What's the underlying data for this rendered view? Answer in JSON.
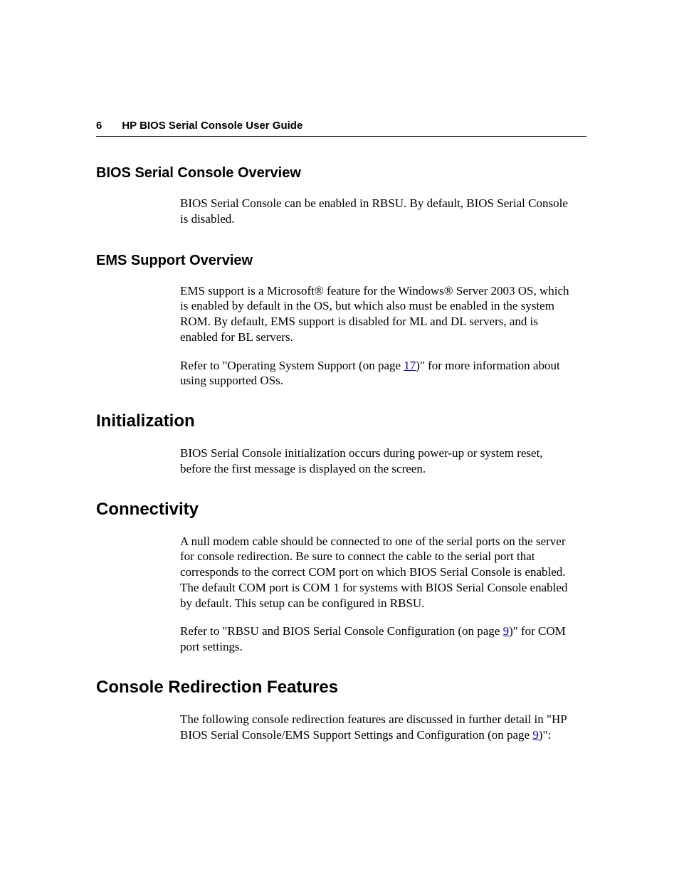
{
  "header": {
    "pageNumber": "6",
    "runningTitle": "HP BIOS Serial Console User Guide"
  },
  "sections": {
    "bios_overview": {
      "heading": "BIOS Serial Console Overview",
      "p1": "BIOS Serial Console can be enabled in RBSU. By default, BIOS Serial Console is disabled."
    },
    "ems_overview": {
      "heading": "EMS Support Overview",
      "p1": "EMS support is a Microsoft® feature for the Windows® Server 2003 OS, which is enabled by default in the OS, but which also must be enabled in the system ROM. By default, EMS support is disabled for ML and DL servers, and is enabled for BL servers.",
      "p2_pre": "Refer to \"Operating System Support (on page ",
      "p2_link": "17",
      "p2_post": ")\" for more information about using supported OSs."
    },
    "initialization": {
      "heading": "Initialization",
      "p1": "BIOS Serial Console initialization occurs during power-up or system reset, before the first message is displayed on the screen."
    },
    "connectivity": {
      "heading": "Connectivity",
      "p1": "A null modem cable should be connected to one of the serial ports on the server for console redirection. Be sure to connect the cable to the serial port that corresponds to the correct COM port on which BIOS Serial Console is enabled. The default COM port is COM 1 for systems with BIOS Serial Console enabled by default. This setup can be configured in RBSU.",
      "p2_pre": "Refer to \"RBSU and BIOS Serial Console Configuration (on page ",
      "p2_link": "9",
      "p2_post": ")\" for COM port settings."
    },
    "console_redirection": {
      "heading": "Console Redirection Features",
      "p1_pre": "The following console redirection features are discussed in further detail in \"HP BIOS Serial Console/EMS Support Settings and Configuration (on page ",
      "p1_link": "9",
      "p1_post": ")\":"
    }
  }
}
